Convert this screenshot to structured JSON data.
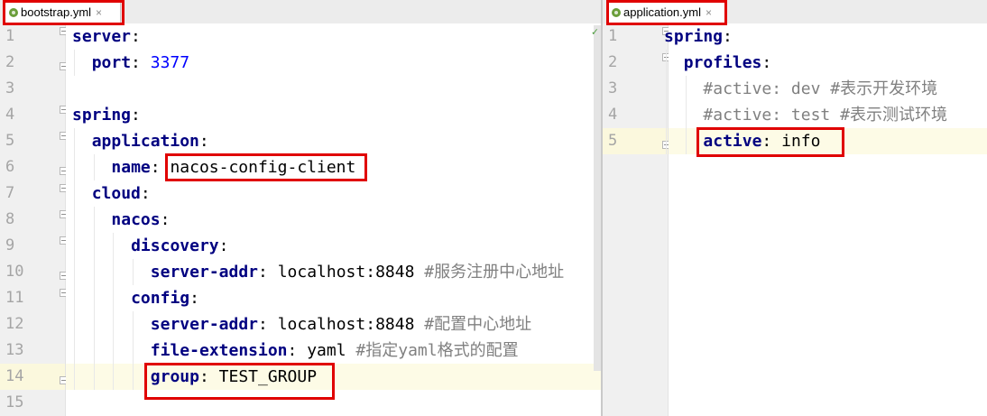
{
  "left_pane": {
    "tab": {
      "filename": "bootstrap.yml",
      "close": "×"
    },
    "lines": [
      {
        "n": "1",
        "key": "server",
        "colon": ":",
        "value": "",
        "comment": ""
      },
      {
        "n": "2",
        "key": "port",
        "colon": ":",
        "value": "3377",
        "comment": ""
      },
      {
        "n": "3",
        "key": "",
        "colon": "",
        "value": "",
        "comment": ""
      },
      {
        "n": "4",
        "key": "spring",
        "colon": ":",
        "value": "",
        "comment": ""
      },
      {
        "n": "5",
        "key": "application",
        "colon": ":",
        "value": "",
        "comment": ""
      },
      {
        "n": "6",
        "key": "name",
        "colon": ":",
        "value": "nacos-config-client",
        "comment": ""
      },
      {
        "n": "7",
        "key": "cloud",
        "colon": ":",
        "value": "",
        "comment": ""
      },
      {
        "n": "8",
        "key": "nacos",
        "colon": ":",
        "value": "",
        "comment": ""
      },
      {
        "n": "9",
        "key": "discovery",
        "colon": ":",
        "value": "",
        "comment": ""
      },
      {
        "n": "10",
        "key": "server-addr",
        "colon": ":",
        "value": "localhost:8848",
        "comment": "#服务注册中心地址"
      },
      {
        "n": "11",
        "key": "config",
        "colon": ":",
        "value": "",
        "comment": ""
      },
      {
        "n": "12",
        "key": "server-addr",
        "colon": ":",
        "value": "localhost:8848",
        "comment": "#配置中心地址"
      },
      {
        "n": "13",
        "key": "file-extension",
        "colon": ":",
        "value": "yaml",
        "comment": "#指定yaml格式的配置"
      },
      {
        "n": "14",
        "key": "group",
        "colon": ":",
        "value": "TEST_GROUP",
        "comment": ""
      },
      {
        "n": "15",
        "key": "",
        "colon": "",
        "value": "",
        "comment": ""
      }
    ]
  },
  "right_pane": {
    "tab": {
      "filename": "application.yml",
      "close": "×"
    },
    "lines": [
      {
        "n": "1",
        "key": "spring",
        "colon": ":",
        "value": "",
        "comment": ""
      },
      {
        "n": "2",
        "key": "profiles",
        "colon": ":",
        "value": "",
        "comment": ""
      },
      {
        "n": "3",
        "key": "",
        "colon": "",
        "value": "",
        "comment": "#active: dev #表示开发环境"
      },
      {
        "n": "4",
        "key": "",
        "colon": "",
        "value": "",
        "comment": "#active: test #表示测试环境"
      },
      {
        "n": "5",
        "key": "active",
        "colon": ":",
        "value": "info",
        "comment": ""
      }
    ]
  },
  "colors": {
    "key": "#000080",
    "number": "#0000ff",
    "comment": "#808080",
    "highlight": "#e00000",
    "current_line": "#fdfbe6"
  }
}
